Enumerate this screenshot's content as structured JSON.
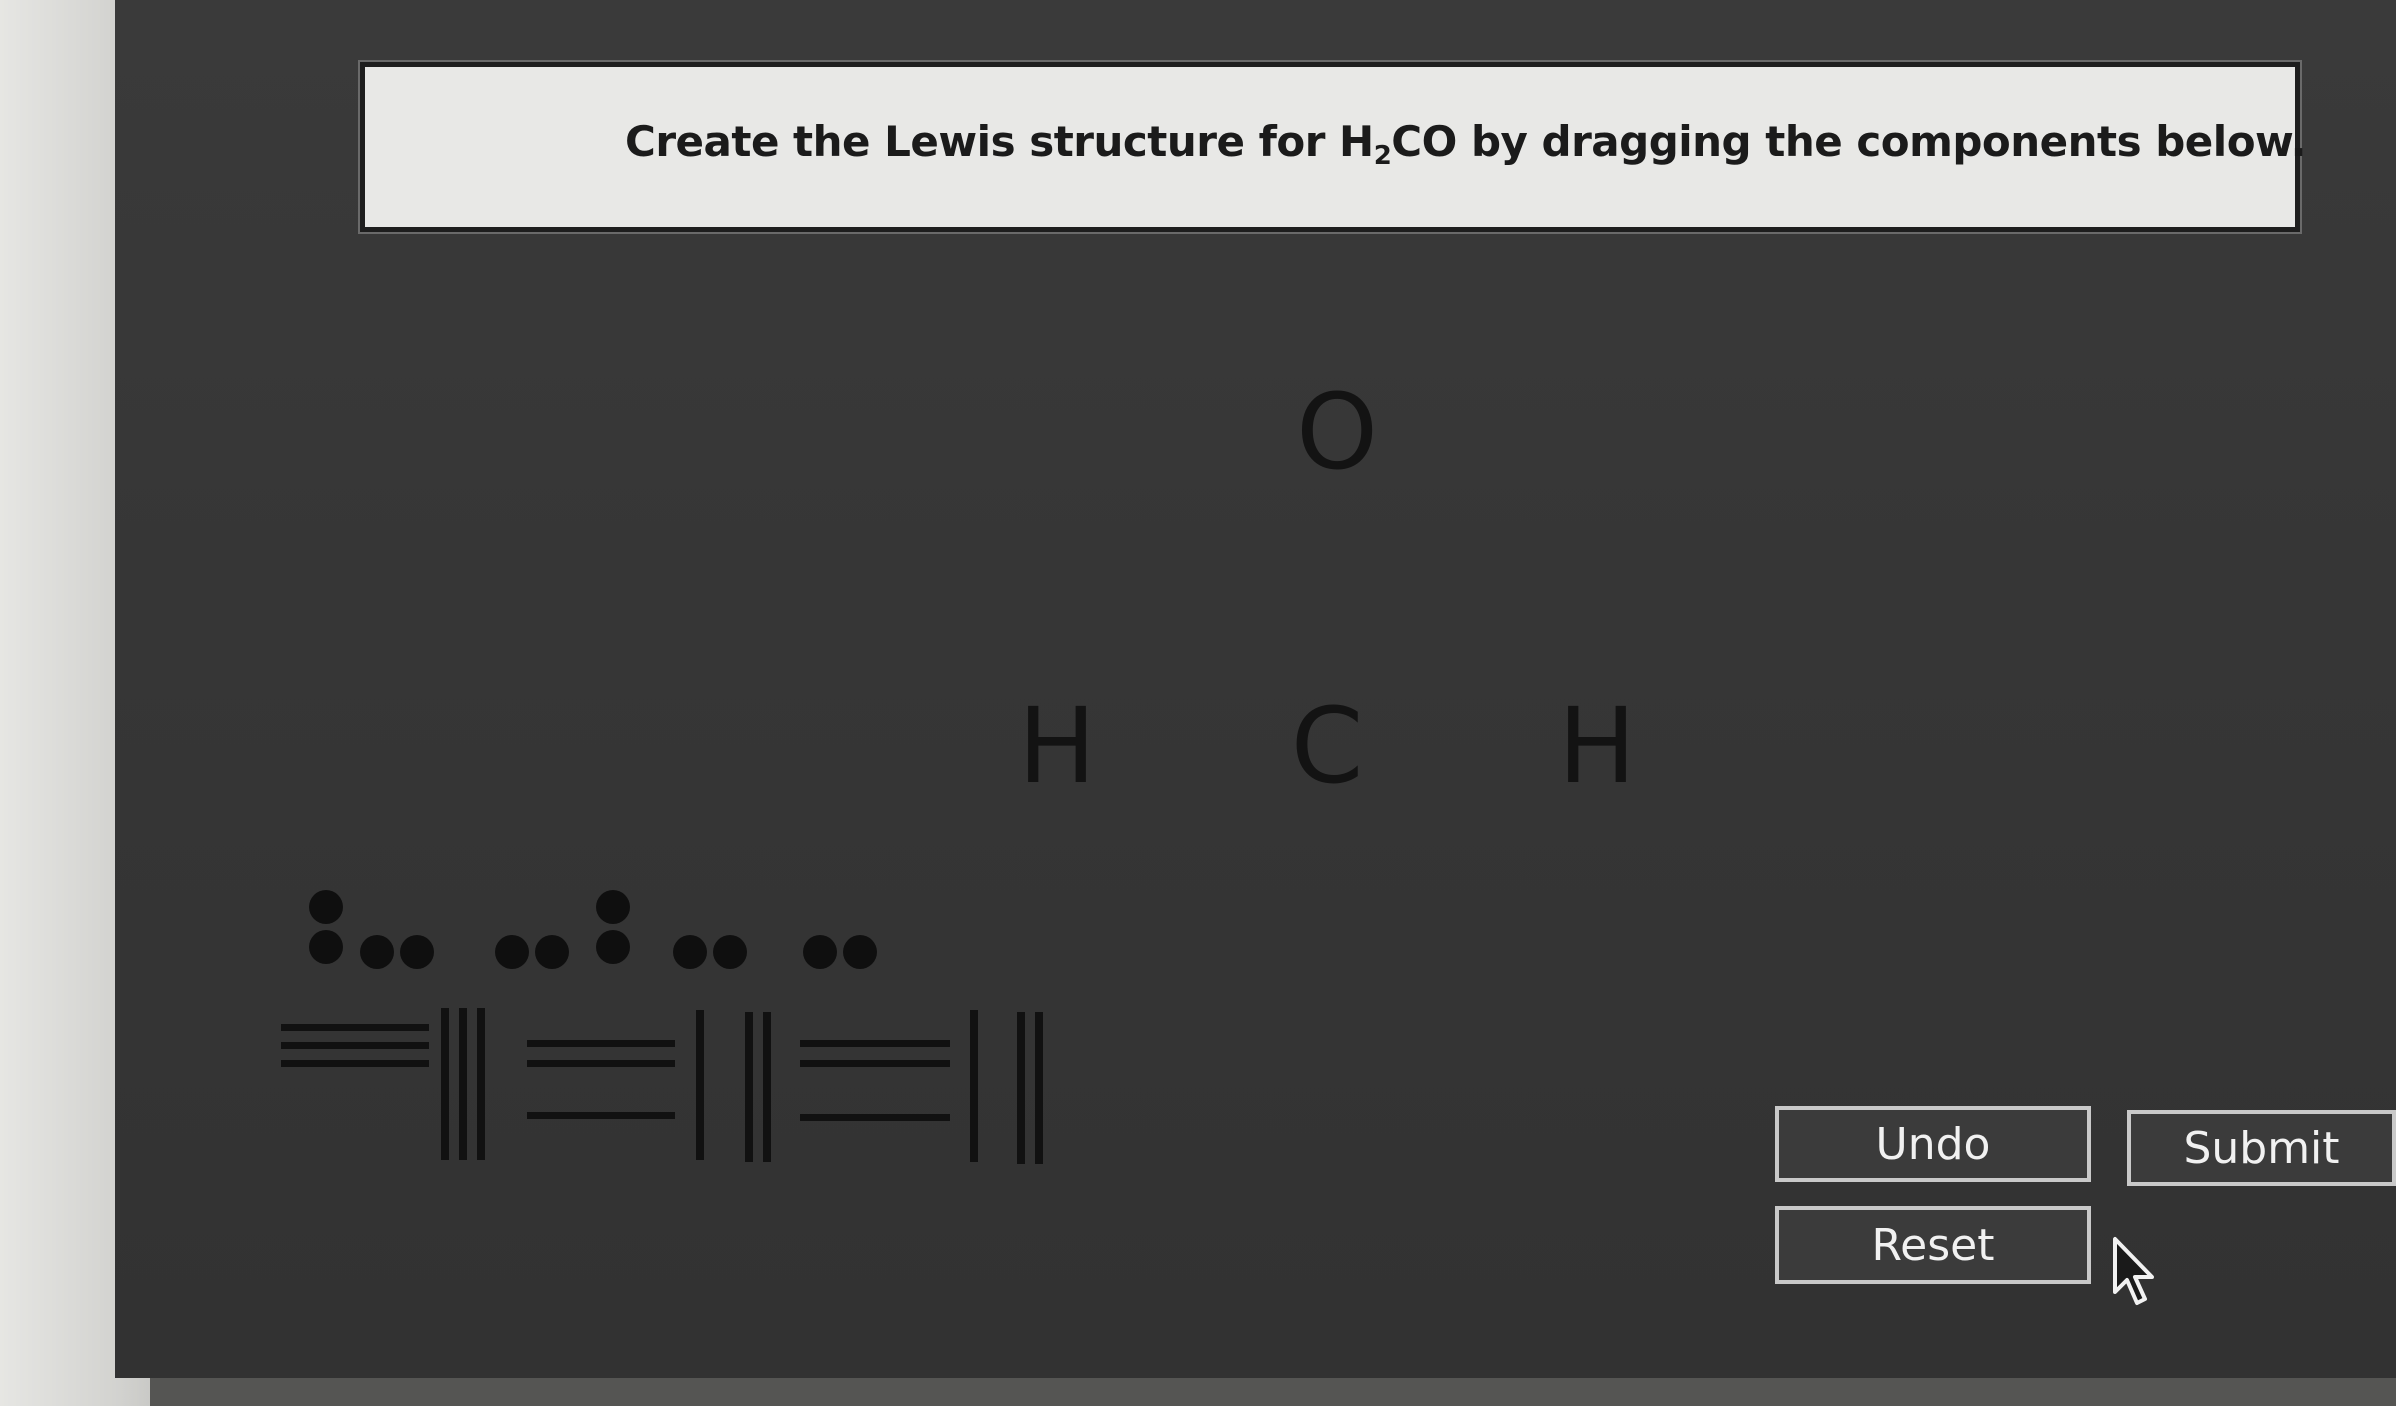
{
  "instruction": {
    "prefix": "Create the Lewis structure for H",
    "subscript": "2",
    "suffix": "CO by dragging the components below."
  },
  "atoms": {
    "top": "O",
    "left": "H",
    "center": "C",
    "right": "H"
  },
  "palette": {
    "lone_pairs": [
      "lone-pair-vertical",
      "lone-pair-horizontal"
    ],
    "bonds": [
      "single",
      "double",
      "triple"
    ]
  },
  "buttons": {
    "undo": "Undo",
    "submit": "Submit",
    "reset": "Reset"
  },
  "colors": {
    "screen_background": "#363636",
    "instruction_background": "#e8e8e6",
    "button_border": "#c9c9c9",
    "button_text": "#f1f1f1"
  },
  "icons": {
    "cursor": "mouse-pointer-icon"
  }
}
